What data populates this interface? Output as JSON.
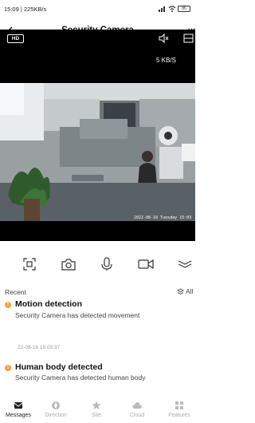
{
  "status": {
    "time_speed": "15:09 | 225KB/s",
    "battery": "85"
  },
  "header": {
    "title": "Security Camera",
    "more": "···"
  },
  "video": {
    "hd_label": "HD",
    "rate": "5 KB/S",
    "timestamp": "2022-08-16 Tuesday 15:03"
  },
  "recent": {
    "label": "Recent",
    "all_label": "All",
    "events": [
      {
        "title": "Motion detection",
        "desc": "Security Camera has detected movement",
        "time": "22-08-16 15:03:37"
      },
      {
        "title": "Human body detected",
        "desc": "Security Camera has detected human body"
      }
    ]
  },
  "tabs": [
    {
      "label": "Messages",
      "icon": "mail-icon"
    },
    {
      "label": "Direction",
      "icon": "direction-icon"
    },
    {
      "label": "Site",
      "icon": "star-icon"
    },
    {
      "label": "Cloud",
      "icon": "cloud-icon"
    },
    {
      "label": "Features",
      "icon": "grid-icon"
    }
  ],
  "colors": {
    "accent": "#f2a23a",
    "active_tab": "#222222",
    "inactive_tab": "#aaaaaa"
  }
}
